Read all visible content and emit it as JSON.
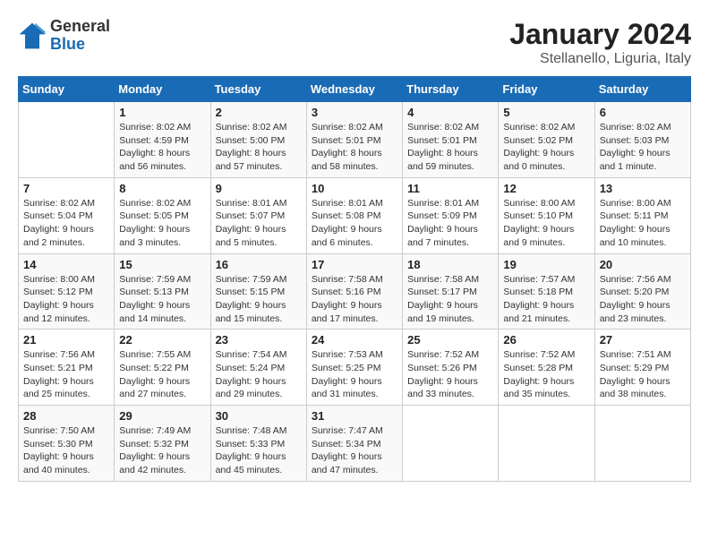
{
  "header": {
    "logo": {
      "general": "General",
      "blue": "Blue"
    },
    "title": "January 2024",
    "location": "Stellanello, Liguria, Italy"
  },
  "days_of_week": [
    "Sunday",
    "Monday",
    "Tuesday",
    "Wednesday",
    "Thursday",
    "Friday",
    "Saturday"
  ],
  "weeks": [
    [
      {
        "day": "",
        "sunrise": "",
        "sunset": "",
        "daylight": ""
      },
      {
        "day": "1",
        "sunrise": "Sunrise: 8:02 AM",
        "sunset": "Sunset: 4:59 PM",
        "daylight": "Daylight: 8 hours and 56 minutes."
      },
      {
        "day": "2",
        "sunrise": "Sunrise: 8:02 AM",
        "sunset": "Sunset: 5:00 PM",
        "daylight": "Daylight: 8 hours and 57 minutes."
      },
      {
        "day": "3",
        "sunrise": "Sunrise: 8:02 AM",
        "sunset": "Sunset: 5:01 PM",
        "daylight": "Daylight: 8 hours and 58 minutes."
      },
      {
        "day": "4",
        "sunrise": "Sunrise: 8:02 AM",
        "sunset": "Sunset: 5:01 PM",
        "daylight": "Daylight: 8 hours and 59 minutes."
      },
      {
        "day": "5",
        "sunrise": "Sunrise: 8:02 AM",
        "sunset": "Sunset: 5:02 PM",
        "daylight": "Daylight: 9 hours and 0 minutes."
      },
      {
        "day": "6",
        "sunrise": "Sunrise: 8:02 AM",
        "sunset": "Sunset: 5:03 PM",
        "daylight": "Daylight: 9 hours and 1 minute."
      }
    ],
    [
      {
        "day": "7",
        "sunrise": "Sunrise: 8:02 AM",
        "sunset": "Sunset: 5:04 PM",
        "daylight": "Daylight: 9 hours and 2 minutes."
      },
      {
        "day": "8",
        "sunrise": "Sunrise: 8:02 AM",
        "sunset": "Sunset: 5:05 PM",
        "daylight": "Daylight: 9 hours and 3 minutes."
      },
      {
        "day": "9",
        "sunrise": "Sunrise: 8:01 AM",
        "sunset": "Sunset: 5:07 PM",
        "daylight": "Daylight: 9 hours and 5 minutes."
      },
      {
        "day": "10",
        "sunrise": "Sunrise: 8:01 AM",
        "sunset": "Sunset: 5:08 PM",
        "daylight": "Daylight: 9 hours and 6 minutes."
      },
      {
        "day": "11",
        "sunrise": "Sunrise: 8:01 AM",
        "sunset": "Sunset: 5:09 PM",
        "daylight": "Daylight: 9 hours and 7 minutes."
      },
      {
        "day": "12",
        "sunrise": "Sunrise: 8:00 AM",
        "sunset": "Sunset: 5:10 PM",
        "daylight": "Daylight: 9 hours and 9 minutes."
      },
      {
        "day": "13",
        "sunrise": "Sunrise: 8:00 AM",
        "sunset": "Sunset: 5:11 PM",
        "daylight": "Daylight: 9 hours and 10 minutes."
      }
    ],
    [
      {
        "day": "14",
        "sunrise": "Sunrise: 8:00 AM",
        "sunset": "Sunset: 5:12 PM",
        "daylight": "Daylight: 9 hours and 12 minutes."
      },
      {
        "day": "15",
        "sunrise": "Sunrise: 7:59 AM",
        "sunset": "Sunset: 5:13 PM",
        "daylight": "Daylight: 9 hours and 14 minutes."
      },
      {
        "day": "16",
        "sunrise": "Sunrise: 7:59 AM",
        "sunset": "Sunset: 5:15 PM",
        "daylight": "Daylight: 9 hours and 15 minutes."
      },
      {
        "day": "17",
        "sunrise": "Sunrise: 7:58 AM",
        "sunset": "Sunset: 5:16 PM",
        "daylight": "Daylight: 9 hours and 17 minutes."
      },
      {
        "day": "18",
        "sunrise": "Sunrise: 7:58 AM",
        "sunset": "Sunset: 5:17 PM",
        "daylight": "Daylight: 9 hours and 19 minutes."
      },
      {
        "day": "19",
        "sunrise": "Sunrise: 7:57 AM",
        "sunset": "Sunset: 5:18 PM",
        "daylight": "Daylight: 9 hours and 21 minutes."
      },
      {
        "day": "20",
        "sunrise": "Sunrise: 7:56 AM",
        "sunset": "Sunset: 5:20 PM",
        "daylight": "Daylight: 9 hours and 23 minutes."
      }
    ],
    [
      {
        "day": "21",
        "sunrise": "Sunrise: 7:56 AM",
        "sunset": "Sunset: 5:21 PM",
        "daylight": "Daylight: 9 hours and 25 minutes."
      },
      {
        "day": "22",
        "sunrise": "Sunrise: 7:55 AM",
        "sunset": "Sunset: 5:22 PM",
        "daylight": "Daylight: 9 hours and 27 minutes."
      },
      {
        "day": "23",
        "sunrise": "Sunrise: 7:54 AM",
        "sunset": "Sunset: 5:24 PM",
        "daylight": "Daylight: 9 hours and 29 minutes."
      },
      {
        "day": "24",
        "sunrise": "Sunrise: 7:53 AM",
        "sunset": "Sunset: 5:25 PM",
        "daylight": "Daylight: 9 hours and 31 minutes."
      },
      {
        "day": "25",
        "sunrise": "Sunrise: 7:52 AM",
        "sunset": "Sunset: 5:26 PM",
        "daylight": "Daylight: 9 hours and 33 minutes."
      },
      {
        "day": "26",
        "sunrise": "Sunrise: 7:52 AM",
        "sunset": "Sunset: 5:28 PM",
        "daylight": "Daylight: 9 hours and 35 minutes."
      },
      {
        "day": "27",
        "sunrise": "Sunrise: 7:51 AM",
        "sunset": "Sunset: 5:29 PM",
        "daylight": "Daylight: 9 hours and 38 minutes."
      }
    ],
    [
      {
        "day": "28",
        "sunrise": "Sunrise: 7:50 AM",
        "sunset": "Sunset: 5:30 PM",
        "daylight": "Daylight: 9 hours and 40 minutes."
      },
      {
        "day": "29",
        "sunrise": "Sunrise: 7:49 AM",
        "sunset": "Sunset: 5:32 PM",
        "daylight": "Daylight: 9 hours and 42 minutes."
      },
      {
        "day": "30",
        "sunrise": "Sunrise: 7:48 AM",
        "sunset": "Sunset: 5:33 PM",
        "daylight": "Daylight: 9 hours and 45 minutes."
      },
      {
        "day": "31",
        "sunrise": "Sunrise: 7:47 AM",
        "sunset": "Sunset: 5:34 PM",
        "daylight": "Daylight: 9 hours and 47 minutes."
      },
      {
        "day": "",
        "sunrise": "",
        "sunset": "",
        "daylight": ""
      },
      {
        "day": "",
        "sunrise": "",
        "sunset": "",
        "daylight": ""
      },
      {
        "day": "",
        "sunrise": "",
        "sunset": "",
        "daylight": ""
      }
    ]
  ]
}
